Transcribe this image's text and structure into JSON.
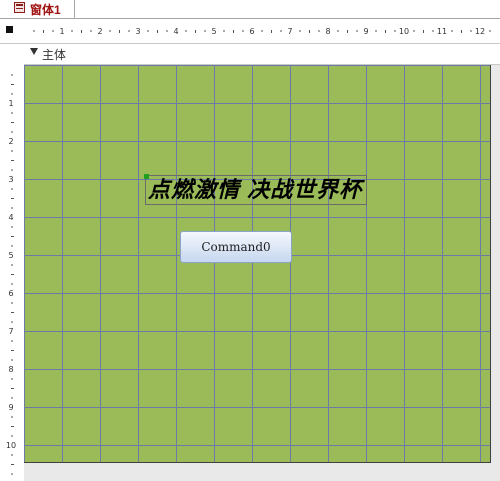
{
  "tab": {
    "title": "窗体1",
    "icon": "form-icon"
  },
  "section": {
    "label": "主体",
    "icon": "section-collapse-icon"
  },
  "ruler": {
    "h_labels": [
      "1",
      "2",
      "3",
      "4",
      "5",
      "6",
      "7",
      "8",
      "9",
      "10",
      "11",
      "12"
    ],
    "v_labels": [
      "1",
      "2",
      "3",
      "4",
      "5",
      "6",
      "7",
      "8",
      "9",
      "10"
    ]
  },
  "form": {
    "background_color": "#9bbb59",
    "grid_color": "#6b7aa6",
    "label_text": "点燃激情 决战世界杯",
    "button_text": "Command0"
  }
}
